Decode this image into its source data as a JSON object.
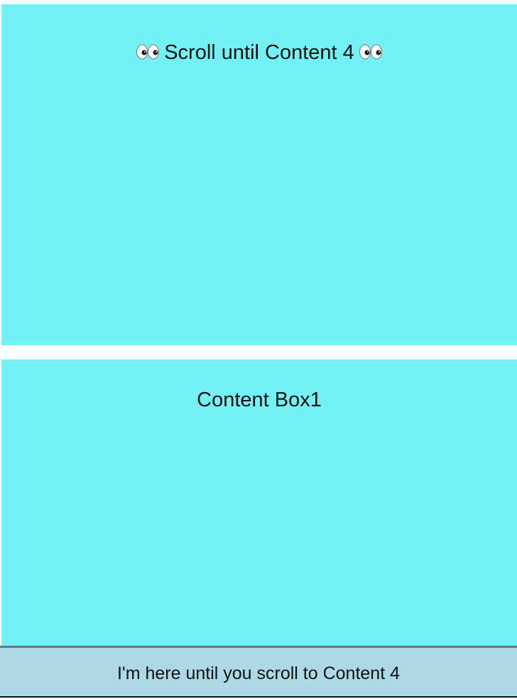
{
  "intro_box": {
    "text": "Scroll until Content 4",
    "left_icon": "eyes-icon",
    "right_icon": "eyes-icon",
    "background": "#74f1f4"
  },
  "content_box_1": {
    "title": "Content Box1",
    "background": "#74f1f4"
  },
  "sticky_footer": {
    "text": "I'm here until you scroll to Content 4",
    "background": "#add8e6"
  }
}
